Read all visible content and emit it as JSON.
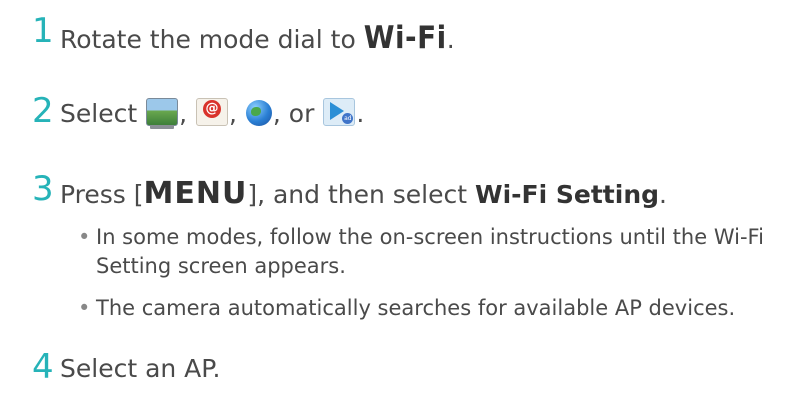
{
  "steps": [
    {
      "number": "1",
      "before": "Rotate the mode dial to ",
      "key": "Wi-Fi",
      "after": "."
    },
    {
      "number": "2",
      "before": "Select ",
      "sep1": ", ",
      "sep2": ", ",
      "sep3": ", or ",
      "after": ".",
      "icons": [
        "photo-upload-icon",
        "email-icon",
        "globe-icon",
        "play-ad-icon"
      ]
    },
    {
      "number": "3",
      "before": "Press [",
      "key": "MENU",
      "middle": "], and then select ",
      "bold": "Wi-Fi Setting",
      "after": "."
    },
    {
      "number": "4",
      "text": "Select an AP."
    }
  ],
  "bullets": [
    "In some modes, follow the on-screen instructions until the Wi-Fi Setting screen appears.",
    "The camera automatically searches for available AP devices."
  ],
  "bullet_symbol": "•",
  "colors": {
    "step_number": "#26b3b8",
    "text": "#4a4a4a"
  }
}
